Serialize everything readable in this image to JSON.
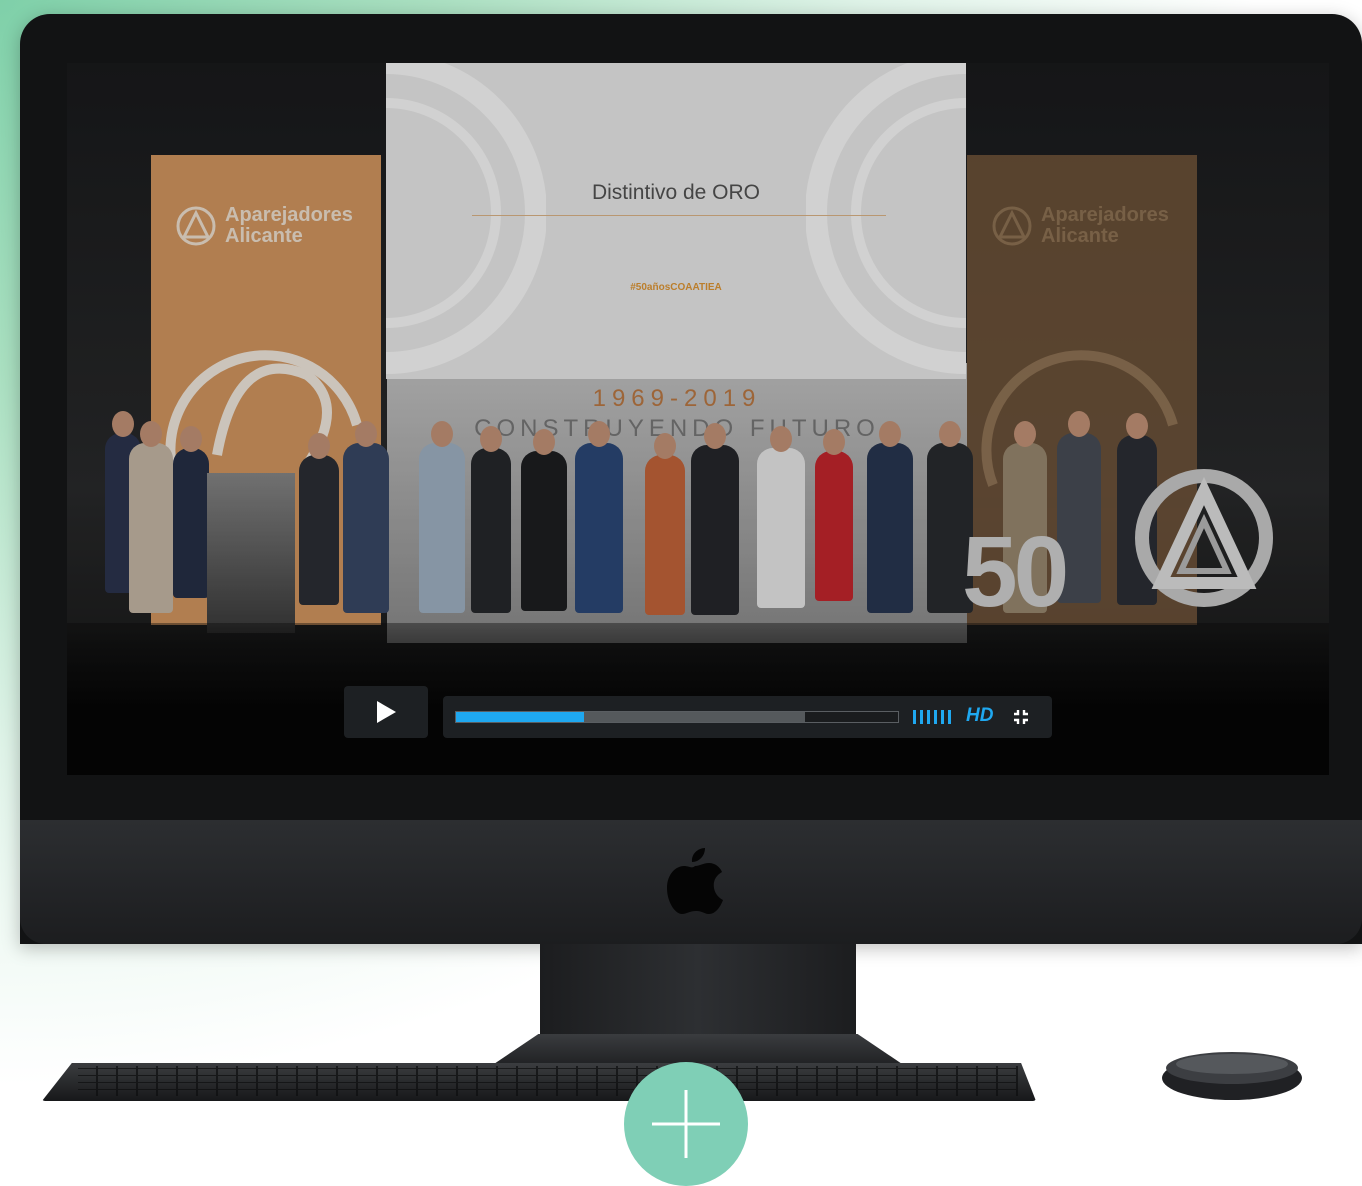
{
  "slide": {
    "title": "Distintivo de ORO",
    "hashtag": "#50añosCOAATIEA"
  },
  "banner": {
    "logo_line1": "Aparejadores",
    "logo_line2": "Alicante"
  },
  "backdrop": {
    "years": "1969-2019",
    "motto": "CONSTRUYENDO FUTURO"
  },
  "stage_number": "50",
  "player": {
    "quality_label": "HD",
    "progress_fraction": 0.29,
    "buffered_fraction": 0.79
  },
  "icons": {
    "play": "play-icon",
    "volume": "volume-icon",
    "fullscreen": "fullscreen-exit-icon",
    "brand": "apple-icon",
    "add": "plus-icon"
  },
  "colors": {
    "accent": "#1fa8f0",
    "add_button": "#7fcfb6",
    "hashtag": "#e59a36",
    "banner": "#d89a62"
  }
}
